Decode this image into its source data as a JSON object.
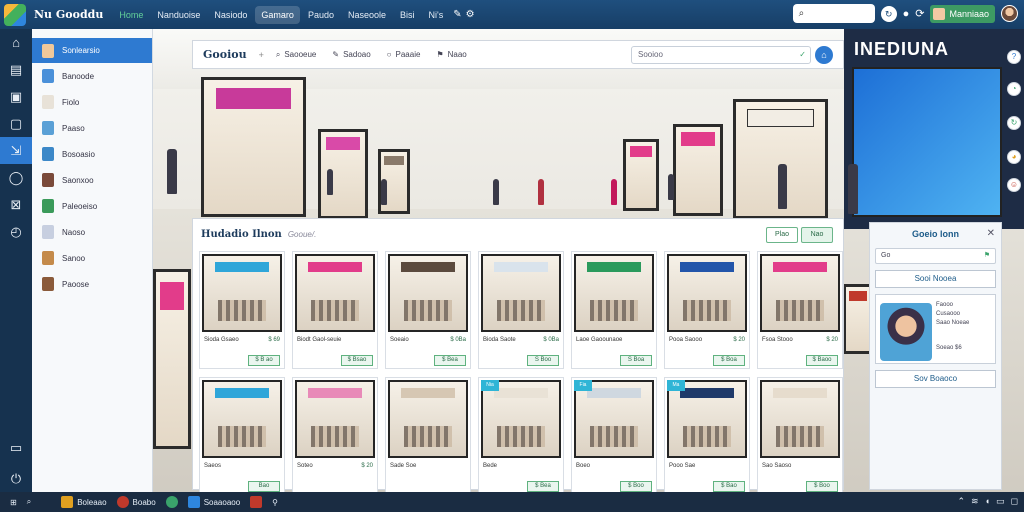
{
  "topbar": {
    "title": "Nu Gooddu",
    "nav": [
      {
        "label": "Home",
        "active": false
      },
      {
        "label": "Nanduoise",
        "active": false
      },
      {
        "label": "Nasiodo",
        "active": false
      },
      {
        "label": "Gamaro",
        "active": true
      },
      {
        "label": "Paudo",
        "active": false
      },
      {
        "label": "Naseoole",
        "active": false
      },
      {
        "label": "Bisi",
        "active": false
      },
      {
        "label": "Ni's",
        "active": false
      }
    ],
    "search_placeholder": "",
    "user_name": "Manniaao"
  },
  "sidebar": {
    "items": [
      {
        "label": "Sonlearsio",
        "active": true,
        "color": "#f0c89a"
      },
      {
        "label": "Banoode",
        "active": false,
        "color": "#4a90d9"
      },
      {
        "label": "Fiolo",
        "active": false,
        "color": "#e8e2d8"
      },
      {
        "label": "Paaso",
        "active": false,
        "color": "#5aa0d6"
      },
      {
        "label": "Bosoasio",
        "active": false,
        "color": "#3c88c8"
      },
      {
        "label": "Saonxoo",
        "active": false,
        "color": "#7a4a3a"
      },
      {
        "label": "Paleoeiso",
        "active": false,
        "color": "#3a9a5a"
      },
      {
        "label": "Naoso",
        "active": false,
        "color": "#c7cfe0"
      },
      {
        "label": "Sanoo",
        "active": false,
        "color": "#c48a4a"
      },
      {
        "label": "Paoose",
        "active": false,
        "color": "#8a5a3a"
      }
    ]
  },
  "filter_bar": {
    "title": "Gooiou",
    "tabs": [
      "Saooeue",
      "Sadoao",
      "Paaaie",
      "Naao"
    ],
    "search_placeholder": "Sooioo"
  },
  "products": {
    "title": "Hudadio Ilnon",
    "subtitle": "Gooue/.",
    "buttons": [
      "Plao",
      "Nao"
    ],
    "items": [
      {
        "name": "Sioda Gsaeo",
        "price": "$ 69",
        "button": "$ B ao",
        "sign": "#2fa6d9"
      },
      {
        "name": "Biodt Gaol-seuie",
        "price": "",
        "button": "$ Bsao",
        "sign": "#e23c8a"
      },
      {
        "name": "Soeaio",
        "price": "$ 0Ba",
        "button": "$ Bea",
        "sign": "#5b4a3e"
      },
      {
        "name": "Bioda Saote",
        "price": "$ 0Ba",
        "button": "S Boo",
        "sign": "#d9e3ec"
      },
      {
        "name": "Laoe Gaoounaoe",
        "price": "",
        "button": "S Boa",
        "sign": "#2a9a5c"
      },
      {
        "name": "Pooa Saooo",
        "price": "$ 20",
        "button": "$ Boa",
        "sign": "#2255aa"
      },
      {
        "name": "Fsoa Stooo",
        "price": "$ 20",
        "button": "$ Baoo",
        "sign": "#e23c8a"
      },
      {
        "name": "Saeos",
        "price": "",
        "button": "Bao",
        "sign": "#2fa6d9"
      },
      {
        "name": "Soteo",
        "price": "$ 20",
        "button": "",
        "sign": "#e88ab8"
      },
      {
        "name": "Sade Soe",
        "price": "",
        "button": "",
        "sign": "#d6c7b3"
      },
      {
        "name": "Bede",
        "price": "",
        "button": "$ Bea",
        "sign": "#e9e2d6",
        "tag": "Nia"
      },
      {
        "name": "Boeo",
        "price": "",
        "button": "$ Boo",
        "sign": "#cfd8e0",
        "tag": "Fia"
      },
      {
        "name": "Pooo Sae",
        "price": "",
        "button": "$ Bao",
        "sign": "#1f3a6a",
        "tag": "Ma"
      },
      {
        "name": "Sao Saoso",
        "price": "",
        "button": "$ Boo",
        "sign": "#e6dccd"
      }
    ]
  },
  "right_panel": {
    "title": "Goeio lonn",
    "input_value": "Go",
    "button_label": "Sooi Nooea",
    "profile_lines": [
      "Faooo",
      "Cusaooo",
      "Saao Noeae"
    ],
    "profile_stat": "Soeao $6",
    "bottom_button": "Sov Boaoco"
  },
  "billboard": {
    "title": "INEDIUNA"
  },
  "taskbar": {
    "items": [
      "Boleaao",
      "Boabo",
      "Soaaoaoo"
    ]
  },
  "colors": {
    "accent": "#2e7ad1",
    "topbar": "#1f4f7e",
    "sidebar_active": "#2e7ad1",
    "success": "#3aa36b"
  }
}
